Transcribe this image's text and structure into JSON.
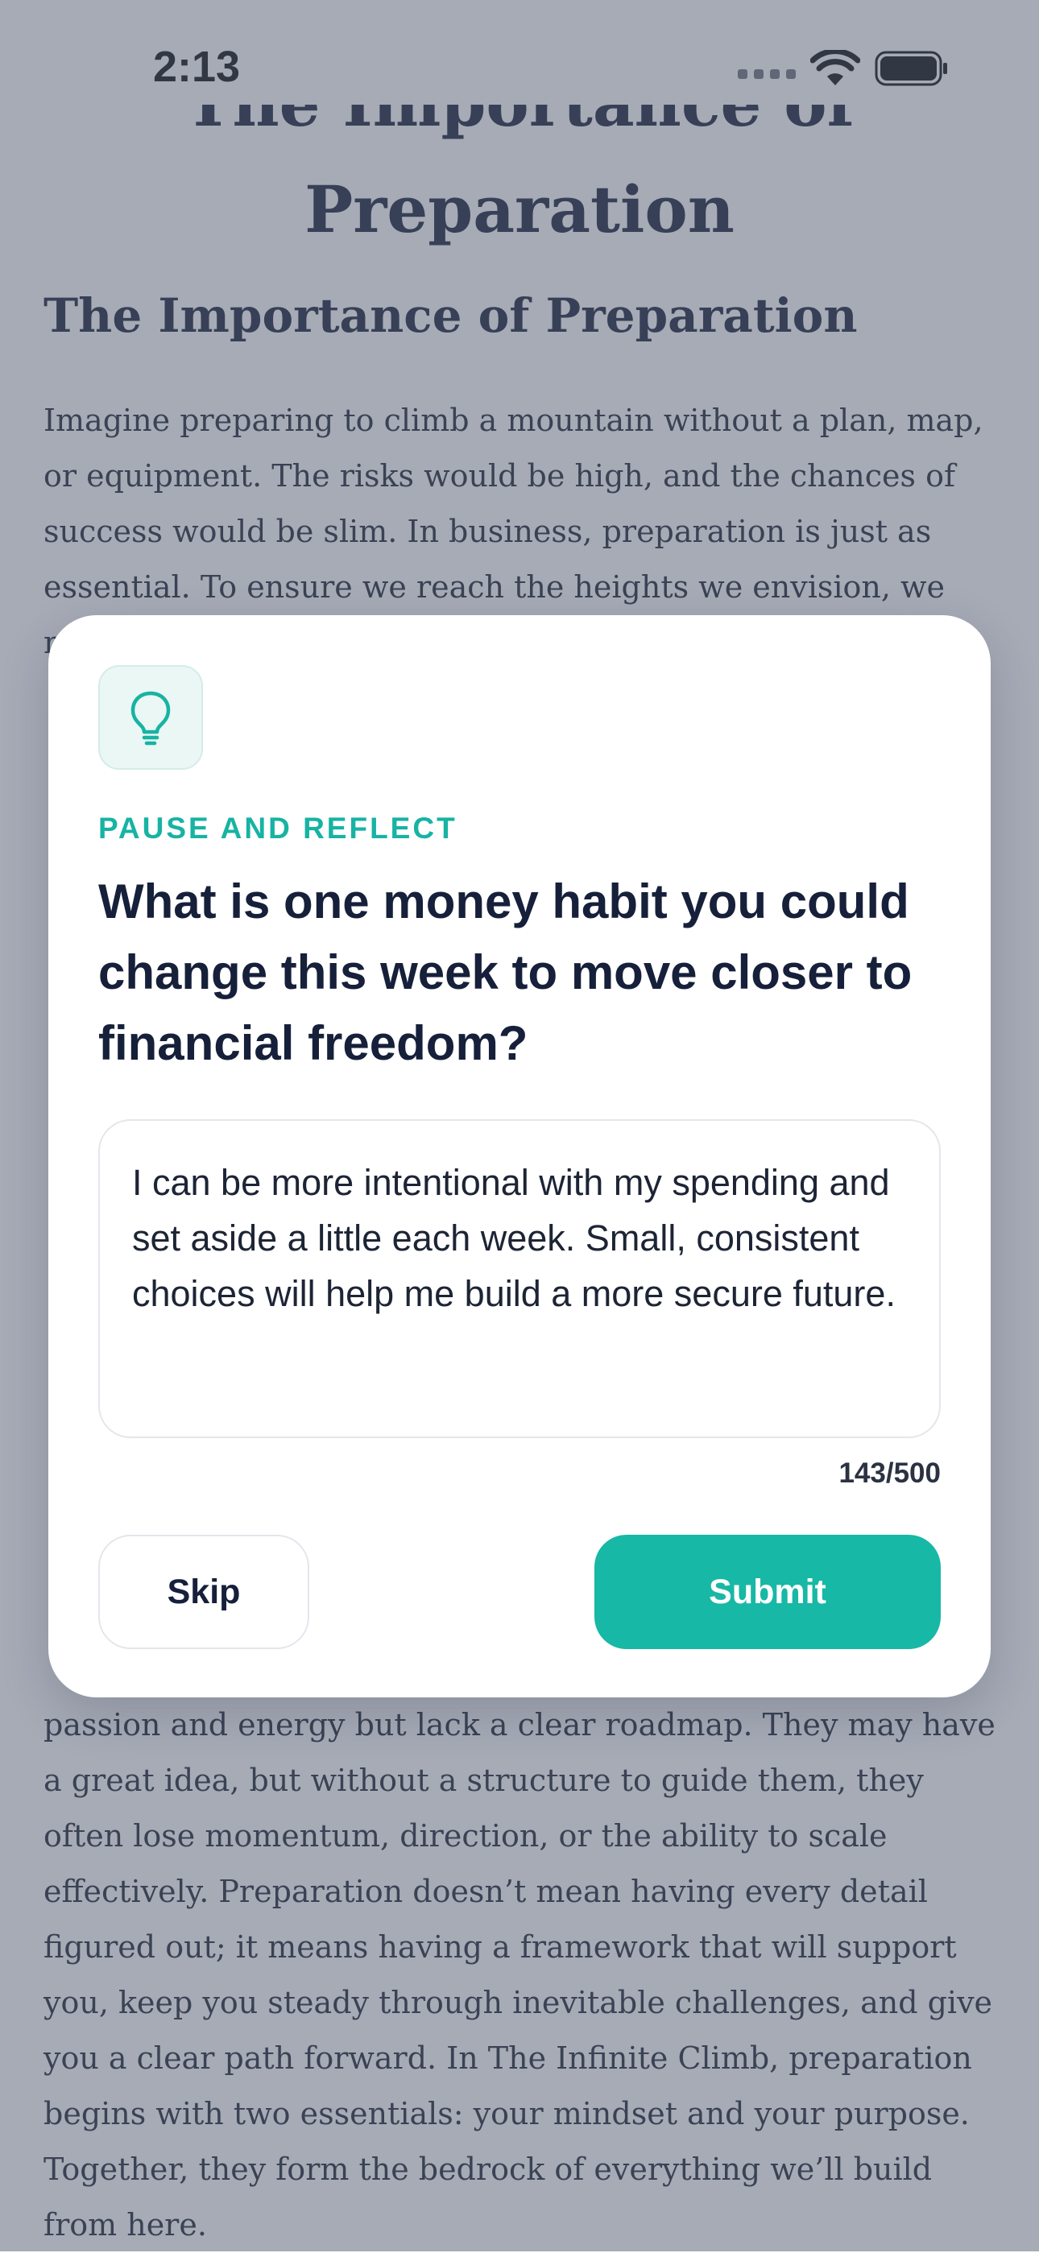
{
  "status_bar": {
    "time": "2:13",
    "icons": [
      "signal-icon",
      "wifi-icon",
      "battery-icon"
    ]
  },
  "article": {
    "title_line1": "The Importance of",
    "title_line2": "Preparation",
    "section_heading": "The Importance of Preparation",
    "paragraph_1": "Imagine preparing to climb a mountain without a plan, map, or equipment. The risks would be high, and the chances of success would be slim. In business, preparation is just as essential. To ensure we reach the heights we envision, we must start by",
    "paragraph_2": "passion and energy but lack a clear roadmap. They may have a great idea, but without a structure to guide them, they often lose momentum, direction, or the ability to scale effectively. Preparation doesn’t mean having every detail figured out; it means having a framework that will support you, keep you steady through inevitable challenges, and give you a clear path forward. In The Infinite Climb, preparation begins with two essentials: your mindset and your purpose. Together, they form the bedrock of everything we’ll build from here."
  },
  "modal": {
    "icon": "lightbulb-icon",
    "eyebrow": "PAUSE AND REFLECT",
    "question": "What is one money habit you could change this week to move closer to financial freedom?",
    "answer": "I can be more intentional with my spending and set aside a little each week. Small, consistent choices will help me build a more secure future.",
    "char_count": "143/500",
    "skip_label": "Skip",
    "submit_label": "Submit"
  },
  "colors": {
    "accent": "#17B8A5",
    "heading": "#16203A",
    "scrim": "#586074"
  }
}
